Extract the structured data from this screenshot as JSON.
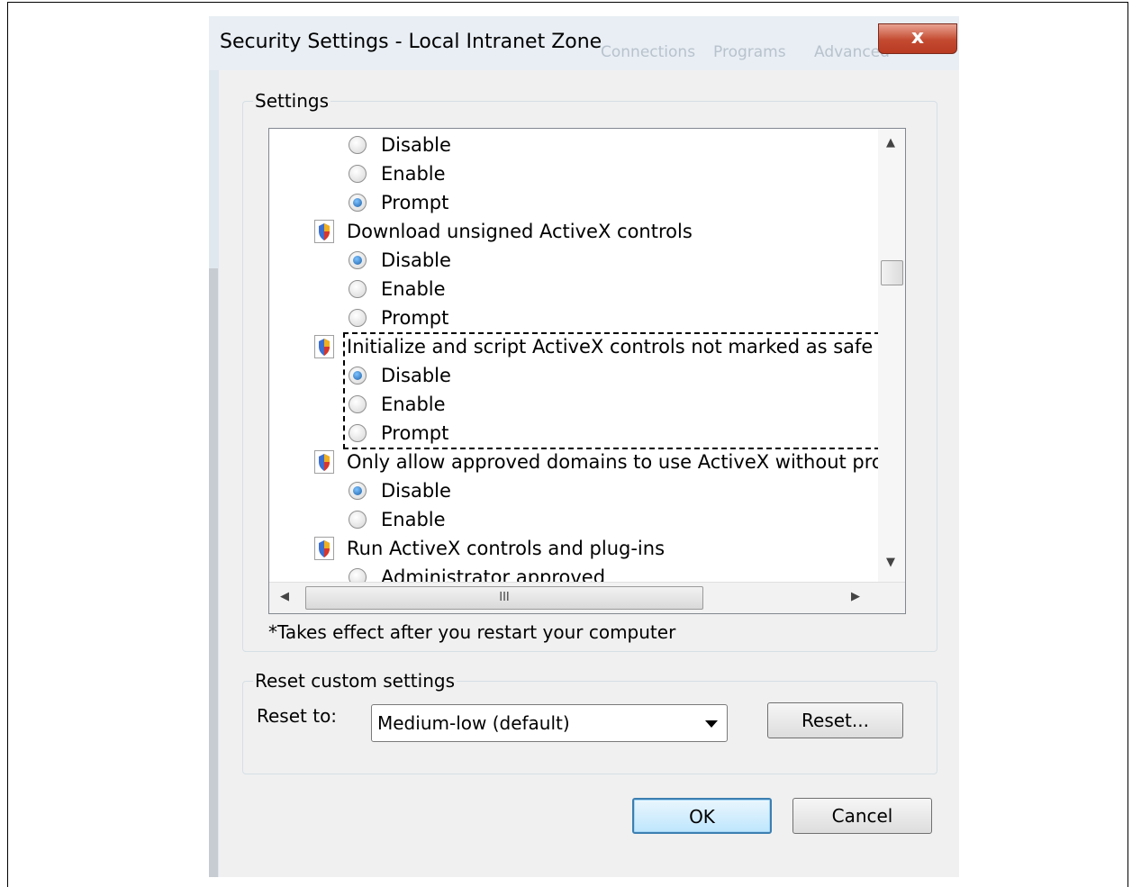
{
  "dialog": {
    "title": "Security Settings - Local Intranet Zone",
    "background_tabs": [
      "Connections",
      "Programs",
      "Advanced"
    ],
    "close_glyph": "x"
  },
  "settings": {
    "group_label": "Settings",
    "items": [
      {
        "kind": "option",
        "label": "Disable",
        "selected": false
      },
      {
        "kind": "option",
        "label": "Enable",
        "selected": false
      },
      {
        "kind": "option",
        "label": "Prompt",
        "selected": true
      },
      {
        "kind": "header",
        "label": "Download unsigned ActiveX controls"
      },
      {
        "kind": "option",
        "label": "Disable",
        "selected": true
      },
      {
        "kind": "option",
        "label": "Enable",
        "selected": false
      },
      {
        "kind": "option",
        "label": "Prompt",
        "selected": false
      },
      {
        "kind": "header",
        "label": "Initialize and script ActiveX controls not marked as safe for scripting"
      },
      {
        "kind": "option",
        "label": "Disable",
        "selected": true
      },
      {
        "kind": "option",
        "label": "Enable",
        "selected": false
      },
      {
        "kind": "option",
        "label": "Prompt",
        "selected": false
      },
      {
        "kind": "header",
        "label": "Only allow approved domains to use ActiveX without prompt"
      },
      {
        "kind": "option",
        "label": "Disable",
        "selected": true
      },
      {
        "kind": "option",
        "label": "Enable",
        "selected": false
      },
      {
        "kind": "header",
        "label": "Run ActiveX controls and plug-ins"
      },
      {
        "kind": "option",
        "label": "Administrator approved",
        "selected": false
      }
    ],
    "hscroll_grip": "III",
    "note": "*Takes effect after you restart your computer"
  },
  "reset": {
    "group_label": "Reset custom settings",
    "reset_to_label": "Reset to:",
    "selected_level": "Medium-low (default)",
    "reset_button": "Reset..."
  },
  "buttons": {
    "ok": "OK",
    "cancel": "Cancel"
  },
  "colors": {
    "radio_selected": "#1a5fa8",
    "close_button": "#c44a30",
    "default_button_border": "#3c7fb1"
  }
}
